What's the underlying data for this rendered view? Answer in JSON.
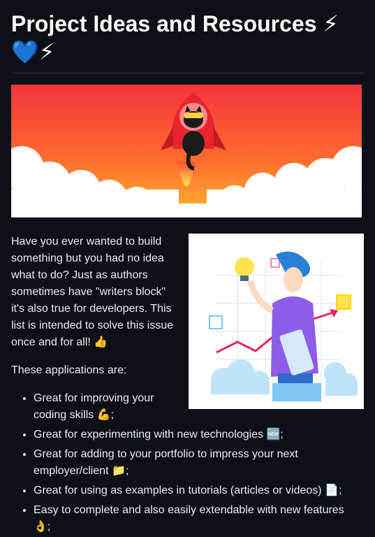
{
  "page": {
    "title": "Project Ideas and Resources ⚡💙⚡",
    "intro": "Have you ever wanted to build something but you had no idea what to do? Just as authors sometimes have \"writers block\" it's also true for developers. This list is intended to solve this issue once and for all! 👍",
    "apps_heading": "These applications are:",
    "benefits": [
      "Great for improving your coding skills 💪;",
      "Great for experimenting with new technologies 🆕;",
      "Great for adding to your portfolio to impress your next employer/client 📁;",
      "Great for using as examples in tutorials (articles or videos) 📄;",
      "Easy to complete and also easily extendable with new features 👌;"
    ]
  },
  "colors": {
    "background": "#0d1117",
    "text": "#e6edf3",
    "banner_top": "#f5333e",
    "banner_bottom": "#ffb62e"
  },
  "icons": {
    "banner": "rocket-cat-illustration",
    "side": "developer-with-lightbulb-illustration"
  }
}
